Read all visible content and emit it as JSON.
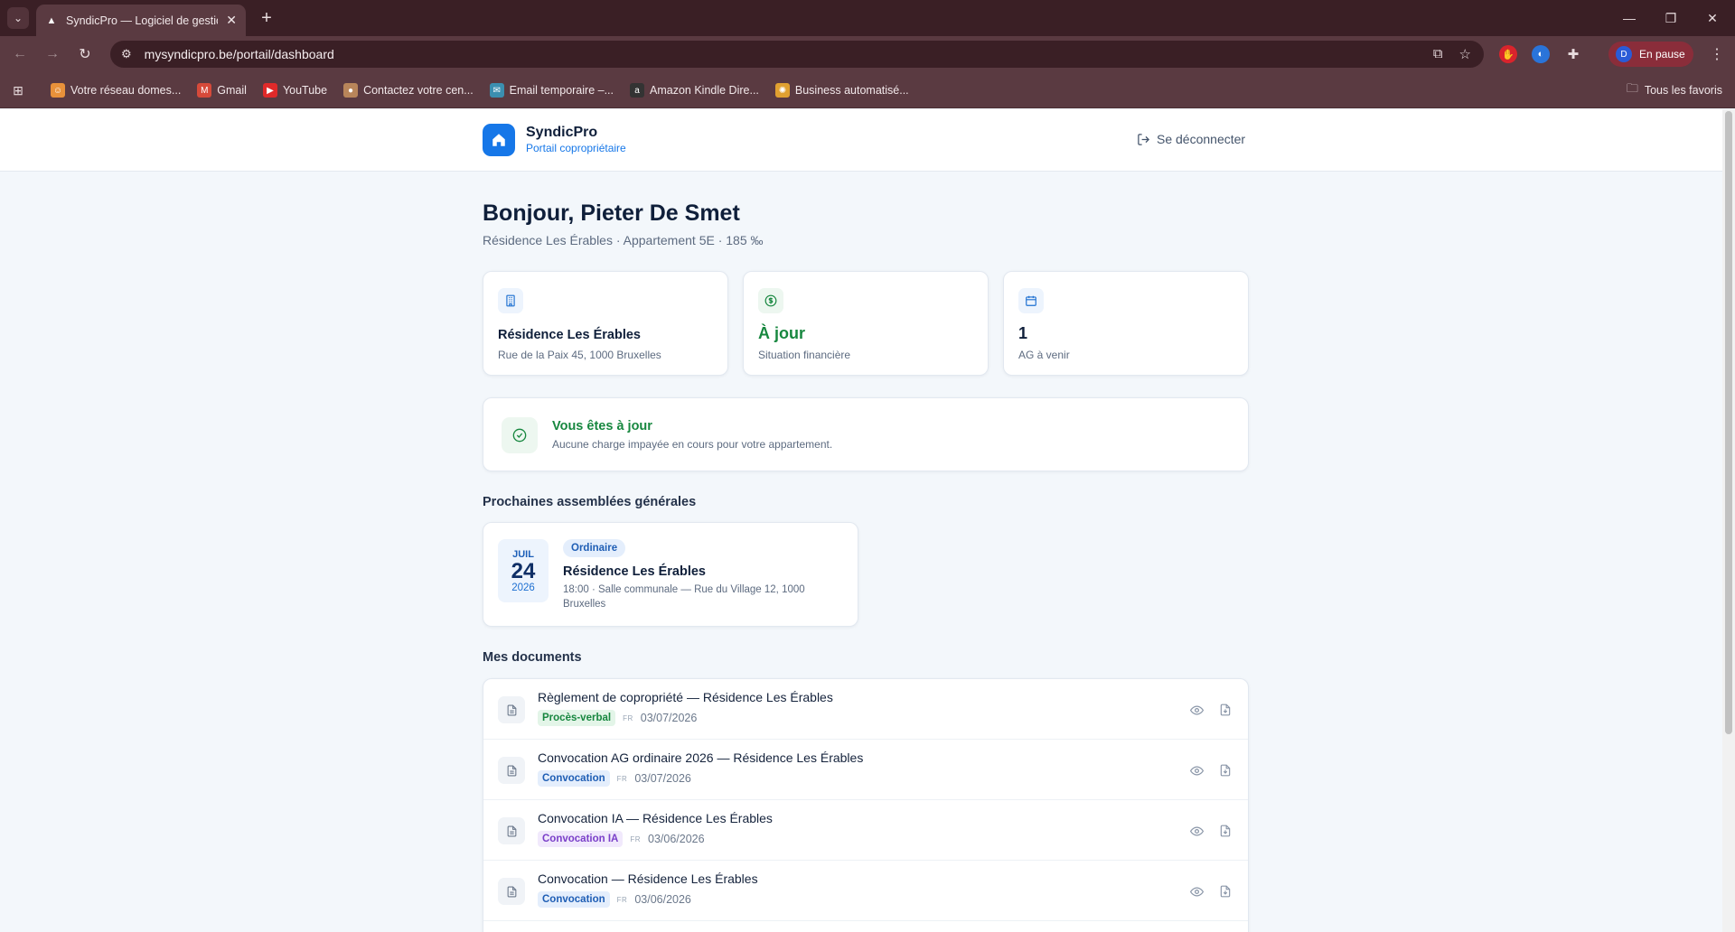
{
  "browser": {
    "tab_title": "SyndicPro — Logiciel de gestio",
    "url": "mysyndicpro.be/portail/dashboard",
    "profile_initial": "D",
    "profile_label": "En pause",
    "bookmarks": [
      {
        "label": "Votre réseau domes...",
        "icon": "smiley-icon",
        "color": "#e8913a"
      },
      {
        "label": "Gmail",
        "icon": "gmail-icon",
        "color": "#d64a3a"
      },
      {
        "label": "YouTube",
        "icon": "youtube-icon",
        "color": "#e02a2a"
      },
      {
        "label": "Contactez votre cen...",
        "icon": "person-icon",
        "color": "#b8855a"
      },
      {
        "label": "Email temporaire –...",
        "icon": "mail-globe-icon",
        "color": "#3b8fb0"
      },
      {
        "label": "Amazon Kindle Dire...",
        "icon": "amazon-icon",
        "color": "#333333"
      },
      {
        "label": "Business automatisé...",
        "icon": "sun-icon",
        "color": "#e0a030"
      }
    ],
    "all_bookmarks_label": "Tous les favoris"
  },
  "app": {
    "brand_name": "SyndicPro",
    "brand_sub": "Portail copropriétaire",
    "logout_label": "Se déconnecter",
    "accent": "#1677e8",
    "success": "#17873f"
  },
  "main": {
    "greeting": "Bonjour, Pieter De Smet",
    "subline": "Résidence Les Érables · Appartement 5E · 185 ‰",
    "stats": [
      {
        "icon": "building-icon",
        "main": "Résidence Les Érables",
        "sub": "Rue de la Paix 45, 1000 Bruxelles"
      },
      {
        "icon": "dollar-icon",
        "main": "À jour",
        "sub": "Situation financière"
      },
      {
        "icon": "calendar-icon",
        "main": "1",
        "sub": "AG à venir"
      }
    ],
    "status": {
      "title": "Vous êtes à jour",
      "description": "Aucune charge impayée en cours pour votre appartement."
    },
    "ag_section_title": "Prochaines assemblées générales",
    "ag": {
      "month": "JUIL",
      "day": "24",
      "year": "2026",
      "type": "Ordinaire",
      "title": "Résidence Les Érables",
      "detail": "18:00 · Salle communale — Rue du Village 12, 1000 Bruxelles"
    },
    "docs_section_title": "Mes documents",
    "documents": [
      {
        "title": "Règlement de copropriété — Résidence Les Érables",
        "tag": "Procès-verbal",
        "tag_color": "#17873f",
        "tag_bg": "#e3f5e8",
        "lang": "FR",
        "date": "03/07/2026"
      },
      {
        "title": "Convocation AG ordinaire 2026 — Résidence Les Érables",
        "tag": "Convocation",
        "tag_color": "#1f5eb5",
        "tag_bg": "#e4eefc",
        "lang": "FR",
        "date": "03/07/2026"
      },
      {
        "title": "Convocation IA — Résidence Les Érables",
        "tag": "Convocation IA",
        "tag_color": "#7a3fc9",
        "tag_bg": "#f1e9fc",
        "lang": "FR",
        "date": "03/06/2026"
      },
      {
        "title": "Convocation — Résidence Les Érables",
        "tag": "Convocation",
        "tag_color": "#1f5eb5",
        "tag_bg": "#e4eefc",
        "lang": "FR",
        "date": "03/06/2026"
      }
    ]
  }
}
